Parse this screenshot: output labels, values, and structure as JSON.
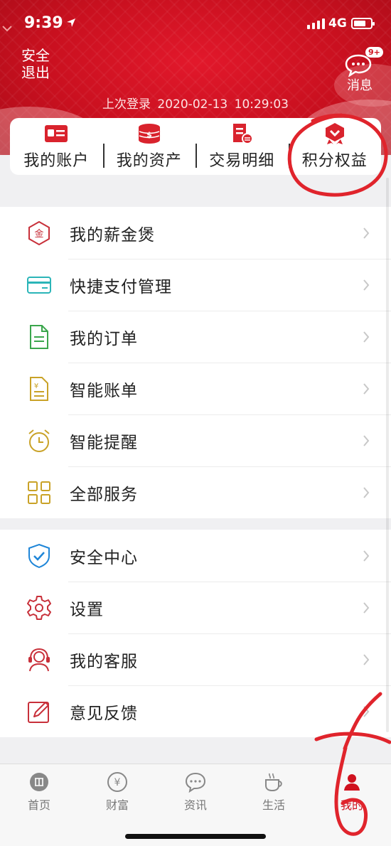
{
  "status_bar": {
    "time": "9:39",
    "network": "4G"
  },
  "header": {
    "logout_label": "安全退出",
    "messages_label": "消息",
    "messages_badge": "9+",
    "last_login_prefix": "上次登录",
    "last_login_date": "2020-02-13",
    "last_login_time": "10:29:03"
  },
  "quick_actions": [
    {
      "label": "我的账户",
      "icon": "id-card-icon"
    },
    {
      "label": "我的资产",
      "icon": "coin-stack-icon"
    },
    {
      "label": "交易明细",
      "icon": "receipt-icon"
    },
    {
      "label": "积分权益",
      "icon": "medal-icon"
    }
  ],
  "menu_group_1": [
    {
      "label": "我的薪金煲",
      "icon": "gold-hexagon-icon",
      "icon_text": "金"
    },
    {
      "label": "快捷支付管理",
      "icon": "card-icon"
    },
    {
      "label": "我的订单",
      "icon": "document-icon"
    },
    {
      "label": "智能账单",
      "icon": "bill-icon"
    },
    {
      "label": "智能提醒",
      "icon": "alarm-clock-icon"
    },
    {
      "label": "全部服务",
      "icon": "grid-icon"
    }
  ],
  "menu_group_2": [
    {
      "label": "安全中心",
      "icon": "shield-icon"
    },
    {
      "label": "设置",
      "icon": "gear-icon"
    },
    {
      "label": "我的客服",
      "icon": "headset-icon"
    },
    {
      "label": "意见反馈",
      "icon": "edit-icon"
    }
  ],
  "tab_bar": [
    {
      "label": "首页",
      "icon": "home-logo-icon"
    },
    {
      "label": "财富",
      "icon": "yen-icon"
    },
    {
      "label": "资讯",
      "icon": "chat-icon"
    },
    {
      "label": "生活",
      "icon": "coffee-icon"
    },
    {
      "label": "我的",
      "icon": "person-icon",
      "active": true
    }
  ],
  "colors": {
    "brand_red": "#d0121f",
    "header_red": "#c9101f",
    "teal": "#2bb5b8",
    "green": "#3aa64c",
    "gold": "#c9a227",
    "blue": "#1f86d8",
    "annotation_red": "#e0242c"
  }
}
